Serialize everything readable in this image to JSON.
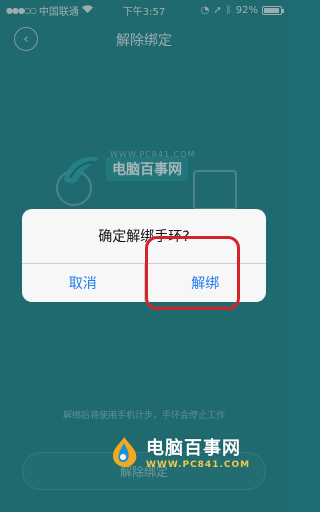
{
  "status_bar": {
    "carrier": "中国联通",
    "time": "下午3:57",
    "battery": "92%",
    "battery_level": 0.92
  },
  "nav": {
    "title": "解除绑定",
    "back_icon": "chevron-left-icon"
  },
  "watermark": {
    "top_name": "电脑百事网",
    "top_url": "WWW.PC841.COM",
    "bottom_name": "电脑百事网",
    "bottom_url": "WWW.PC841.COM"
  },
  "main": {
    "hint": "解绑后将使用手机计步，手环会停止工作",
    "unbind_button": "解除绑定"
  },
  "dialog": {
    "message": "确定解绑手环?",
    "cancel": "取消",
    "confirm": "解绑"
  },
  "colors": {
    "background": "#2a8b90",
    "dialog_button": "#1f7cf2",
    "highlight": "#d4242b"
  }
}
